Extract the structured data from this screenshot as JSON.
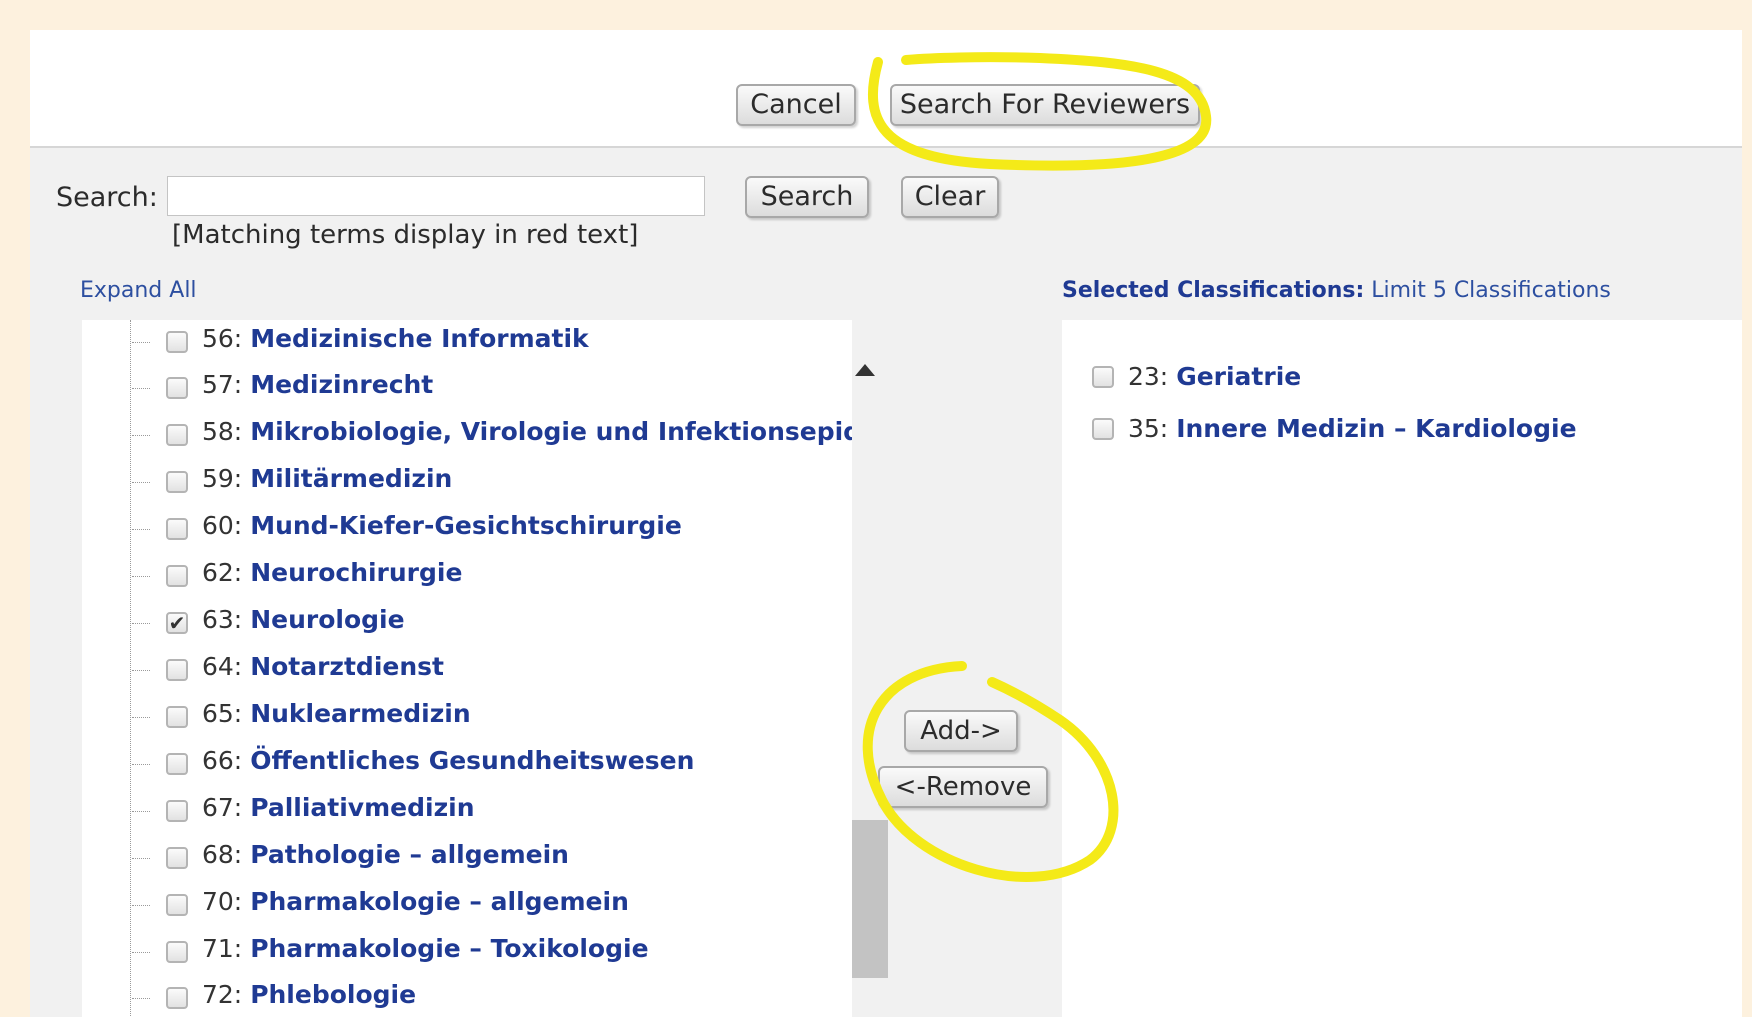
{
  "header": {
    "cancel_label": "Cancel",
    "search_reviewers_label": "Search For Reviewers"
  },
  "search": {
    "label": "Search:",
    "value": "",
    "placeholder": "",
    "search_button": "Search",
    "clear_button": "Clear",
    "hint": "[Matching terms display in red text]"
  },
  "tree": {
    "expand_all": "Expand All",
    "items": [
      {
        "num": "56:",
        "term": "Medizinische Informatik",
        "checked": false
      },
      {
        "num": "57:",
        "term": "Medizinrecht",
        "checked": false
      },
      {
        "num": "58:",
        "term": "Mikrobiologie, Virologie und Infektionsepider",
        "checked": false
      },
      {
        "num": "59:",
        "term": "Militärmedizin",
        "checked": false
      },
      {
        "num": "60:",
        "term": "Mund-Kiefer-Gesichtschirurgie",
        "checked": false
      },
      {
        "num": "62:",
        "term": "Neurochirurgie",
        "checked": false
      },
      {
        "num": "63:",
        "term": "Neurologie",
        "checked": true
      },
      {
        "num": "64:",
        "term": "Notarztdienst",
        "checked": false
      },
      {
        "num": "65:",
        "term": "Nuklearmedizin",
        "checked": false
      },
      {
        "num": "66:",
        "term": "Öffentliches Gesundheitswesen",
        "checked": false
      },
      {
        "num": "67:",
        "term": "Palliativmedizin",
        "checked": false
      },
      {
        "num": "68:",
        "term": "Pathologie – allgemein",
        "checked": false
      },
      {
        "num": "70:",
        "term": "Pharmakologie – allgemein",
        "checked": false
      },
      {
        "num": "71:",
        "term": "Pharmakologie – Toxikologie",
        "checked": false
      },
      {
        "num": "72:",
        "term": "Phlebologie",
        "checked": false
      }
    ]
  },
  "actions": {
    "add_label": "Add->",
    "remove_label": "<-Remove"
  },
  "selected": {
    "heading": "Selected Classifications:",
    "limit": "Limit 5 Classifications",
    "items": [
      {
        "num": "23:",
        "term": "Geriatrie",
        "checked": false
      },
      {
        "num": "35:",
        "term": "Innere Medizin – Kardiologie",
        "checked": false
      }
    ]
  },
  "colors": {
    "background": "#fdf1de",
    "term_blue": "#1f3a93",
    "link_blue": "#2d4fa0",
    "highlight_yellow": "#f4ea18"
  }
}
